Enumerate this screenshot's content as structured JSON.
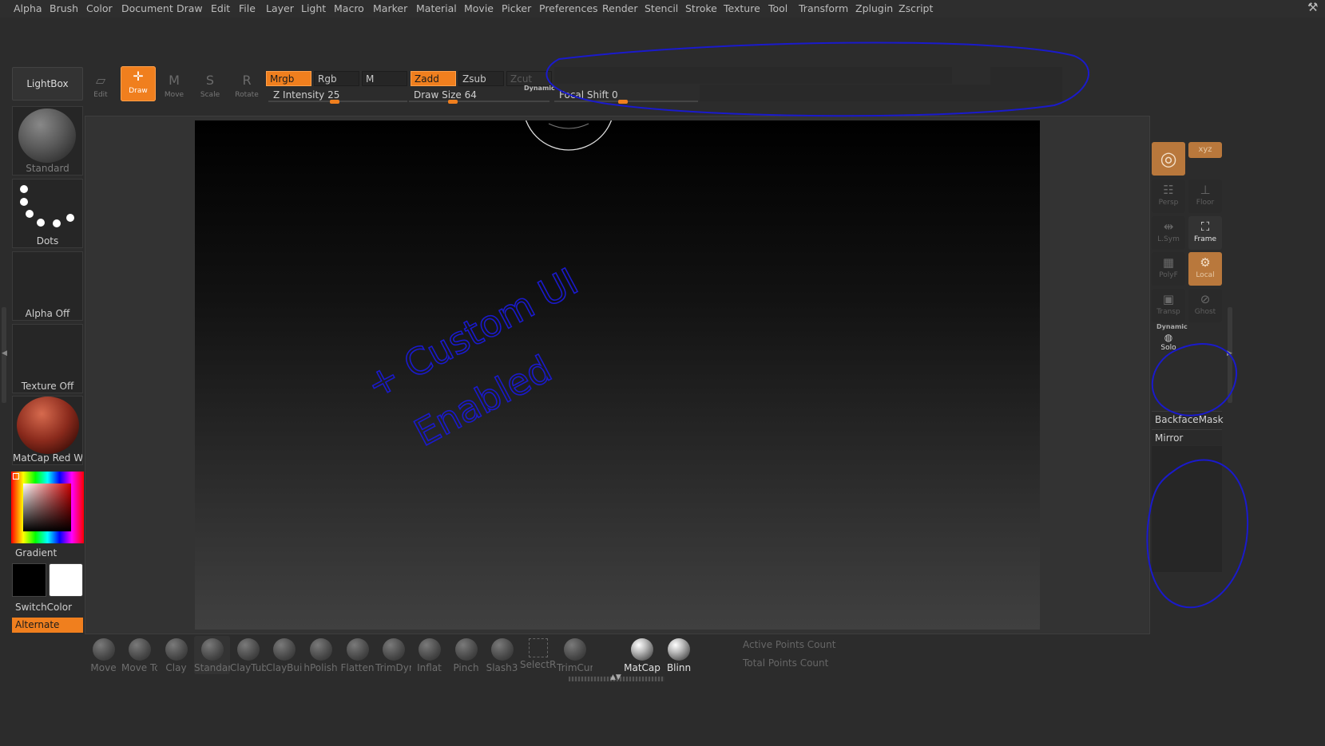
{
  "menu": [
    "Alpha",
    "Brush",
    "Color",
    "Document",
    "Draw",
    "Edit",
    "File",
    "Layer",
    "Light",
    "Macro",
    "Marker",
    "Material",
    "Movie",
    "Picker",
    "Preferences",
    "Render",
    "Stencil",
    "Stroke",
    "Texture",
    "Tool",
    "Transform",
    "Zplugin",
    "Zscript"
  ],
  "toolbar": {
    "lightbox": "LightBox",
    "modes": [
      {
        "label": "Edit",
        "glyph": "▱"
      },
      {
        "label": "Draw",
        "glyph": "✛"
      },
      {
        "label": "Move",
        "glyph": "M"
      },
      {
        "label": "Scale",
        "glyph": "S"
      },
      {
        "label": "Rotate",
        "glyph": "R"
      }
    ],
    "mrgb": "Mrgb",
    "rgb": "Rgb",
    "m": "M",
    "zadd": "Zadd",
    "zsub": "Zsub",
    "zcut": "Zcut",
    "z_intensity": "Z Intensity 25",
    "draw_size": "Draw Size 64",
    "dynamic": "Dynamic",
    "focal_shift": "Focal Shift 0",
    "z_intensity_value": 25,
    "draw_size_value": 64,
    "focal_shift_value": 0
  },
  "left_shelf": {
    "brush": "Standard",
    "stroke": "Dots",
    "alpha": "Alpha Off",
    "texture": "Texture Off",
    "material": "MatCap Red Wax",
    "gradient": "Gradient",
    "switch_color": "SwitchColor",
    "alternate": "Alternate",
    "main_color": "#000000",
    "secondary_color": "#ffffff"
  },
  "right_shelf": {
    "buttons": [
      {
        "label": "",
        "glyph": "◎",
        "icon": "bpr-icon"
      },
      {
        "label": "xyz",
        "glyph": "",
        "icon": "xyz-icon"
      },
      {
        "label": "Persp",
        "glyph": "☷",
        "icon": "persp-icon"
      },
      {
        "label": "Floor",
        "glyph": "⊥",
        "icon": "floor-icon"
      },
      {
        "label": "L.Sym",
        "glyph": "⇹",
        "icon": "lsym-icon"
      },
      {
        "label": "Frame",
        "glyph": "⛶",
        "icon": "frame-icon"
      },
      {
        "label": "PolyF",
        "glyph": "▦",
        "icon": "polyf-icon"
      },
      {
        "label": "Local",
        "glyph": "⚙",
        "icon": "local-icon"
      },
      {
        "label": "Transp",
        "glyph": "▣",
        "icon": "transp-icon"
      },
      {
        "label": "Ghost",
        "glyph": "⊘",
        "icon": "ghost-icon"
      }
    ],
    "dynamic": "Dynamic",
    "solo": "Solo",
    "backface": "BackfaceMask",
    "mirror": "Mirror"
  },
  "annotation": {
    "line1": "+ Custom UI",
    "line2": "Enabled",
    "color": "#1a1acc"
  },
  "bottom_shelf": {
    "brushes": [
      "Move",
      "Move Tc",
      "Clay",
      "Standar",
      "ClayTub",
      "ClayBuil",
      "hPolish",
      "Flatten",
      "TrimDyr",
      "Inflat",
      "Pinch",
      "Slash3",
      "SelectRe",
      "TrimCur"
    ],
    "materials": [
      "MatCap",
      "Blinn"
    ],
    "active_points": "Active Points Count",
    "total_points": "Total Points Count"
  }
}
